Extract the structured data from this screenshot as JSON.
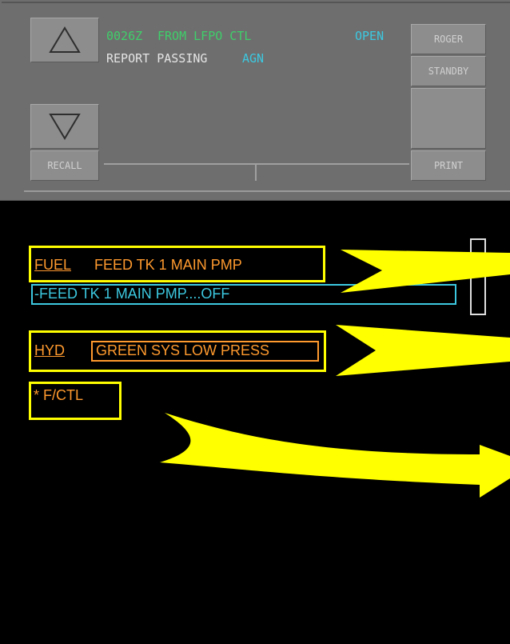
{
  "dcdu": {
    "time": "0026Z",
    "origin": "FROM LFPO CTL",
    "status": "OPEN",
    "message_prefix": "REPORT PASSING",
    "message_suffix": "AGN",
    "buttons": {
      "recall": "RECALL",
      "roger": "ROGER",
      "standby": "STANDBY",
      "print": "PRINT"
    },
    "icons": [
      "triangle-up-icon",
      "triangle-down-icon"
    ]
  },
  "ecam": {
    "fuel": {
      "system": "FUEL",
      "title": "FEED TK 1 MAIN PMP",
      "action": "-FEED TK 1 MAIN PMP....OFF"
    },
    "hyd": {
      "system": "HYD",
      "title": "GREEN SYS LOW PRESS"
    },
    "fctl": {
      "label": "* F/CTL"
    }
  },
  "colors": {
    "amber": "#ff9a2e",
    "cyan": "#3cc8e0",
    "green": "#3fcf6a",
    "yellow_highlight": "#ffff00",
    "panel_grey": "#6e6e6e"
  }
}
